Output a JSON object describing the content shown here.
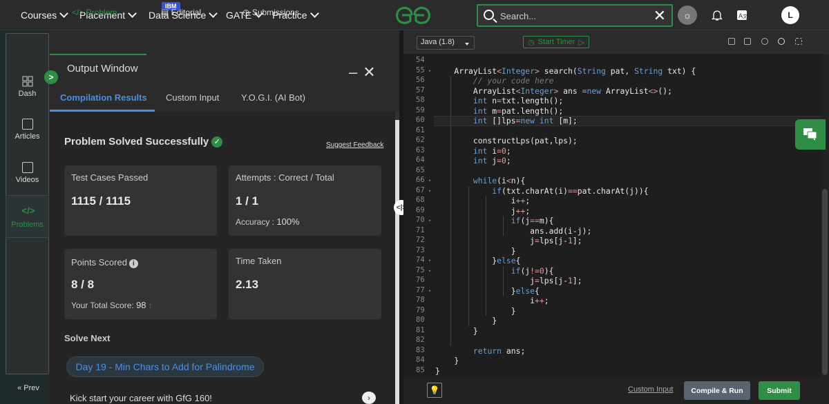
{
  "topnav": {
    "items": [
      {
        "label": "Courses"
      },
      {
        "label": "Placement"
      },
      {
        "label": "Data Science"
      },
      {
        "label": "GATE"
      },
      {
        "label": "Practice"
      }
    ],
    "badge": "IBM",
    "search_placeholder": "Search...",
    "avatar_letter": "L"
  },
  "sidebar": {
    "items": [
      {
        "label": "Dash",
        "icon": "dashboard-icon"
      },
      {
        "label": "Articles",
        "icon": "book-icon"
      },
      {
        "label": "Videos",
        "icon": "video-icon"
      },
      {
        "label": "Problems",
        "icon": "code-icon"
      }
    ],
    "prev_label": "« Prev"
  },
  "problem_tabs": [
    {
      "label": "</> Problem"
    },
    {
      "label": "Editorial"
    },
    {
      "label": "Submissions"
    }
  ],
  "output": {
    "title": "Output Window",
    "tabs": [
      {
        "label": "Compilation Results"
      },
      {
        "label": "Custom Input"
      },
      {
        "label": "Y.O.G.I. (AI Bot)"
      }
    ],
    "status": "Problem Solved Successfully",
    "feedback": "Suggest Feedback",
    "cards": {
      "tests_label": "Test Cases Passed",
      "tests_value": "1115 / 1115",
      "attempts_label": "Attempts : Correct / Total",
      "attempts_value": "1 / 1",
      "accuracy_label": "Accuracy :",
      "accuracy_value": "100%",
      "points_label": "Points Scored",
      "points_value": "8 / 8",
      "total_label": "Your Total Score:",
      "total_value": "98",
      "time_label": "Time Taken",
      "time_value": "2.13"
    },
    "solve_next_label": "Solve Next",
    "next_problem": "Day 19 - Min Chars to Add for Palindrome",
    "kickstart": "Kick start your career with GfG 160!"
  },
  "editor": {
    "language": "Java (1.8)",
    "timer_label": "Start Timer",
    "custom_input": "Custom Input",
    "compile_run": "Compile & Run",
    "submit": "Submit",
    "code_lines": [
      {
        "n": "54",
        "text": ""
      },
      {
        "n": "55",
        "text": "    ArrayList<Integer> search(String pat, String txt) {"
      },
      {
        "n": "56",
        "text": "        // your code here"
      },
      {
        "n": "57",
        "text": "        ArrayList<Integer> ans =new ArrayList<>();"
      },
      {
        "n": "58",
        "text": "        int n=txt.length();"
      },
      {
        "n": "59",
        "text": "        int m=pat.length();"
      },
      {
        "n": "60",
        "text": "        int []lps=new int [m];"
      },
      {
        "n": "61",
        "text": ""
      },
      {
        "n": "62",
        "text": "        constructLps(pat,lps);"
      },
      {
        "n": "63",
        "text": "        int i=0;"
      },
      {
        "n": "64",
        "text": "        int j=0;"
      },
      {
        "n": "65",
        "text": ""
      },
      {
        "n": "66",
        "text": "        while(i<n){"
      },
      {
        "n": "67",
        "text": "            if(txt.charAt(i)==pat.charAt(j)){"
      },
      {
        "n": "68",
        "text": "                i++;"
      },
      {
        "n": "69",
        "text": "                j++;"
      },
      {
        "n": "70",
        "text": "                if(j==m){"
      },
      {
        "n": "71",
        "text": "                    ans.add(i-j);"
      },
      {
        "n": "72",
        "text": "                    j=lps[j-1];"
      },
      {
        "n": "73",
        "text": "                }"
      },
      {
        "n": "74",
        "text": "            }else{"
      },
      {
        "n": "75",
        "text": "                if(j!=0){"
      },
      {
        "n": "76",
        "text": "                    j=lps[j-1];"
      },
      {
        "n": "77",
        "text": "                }else{"
      },
      {
        "n": "78",
        "text": "                    i++;"
      },
      {
        "n": "79",
        "text": "                }"
      },
      {
        "n": "80",
        "text": "            }"
      },
      {
        "n": "81",
        "text": "        }"
      },
      {
        "n": "82",
        "text": ""
      },
      {
        "n": "83",
        "text": "        return ans;"
      },
      {
        "n": "84",
        "text": "    }"
      },
      {
        "n": "85",
        "text": "}"
      }
    ]
  },
  "colors": {
    "accent_green": "#2f8d46",
    "accent_blue": "#4a90e2"
  }
}
